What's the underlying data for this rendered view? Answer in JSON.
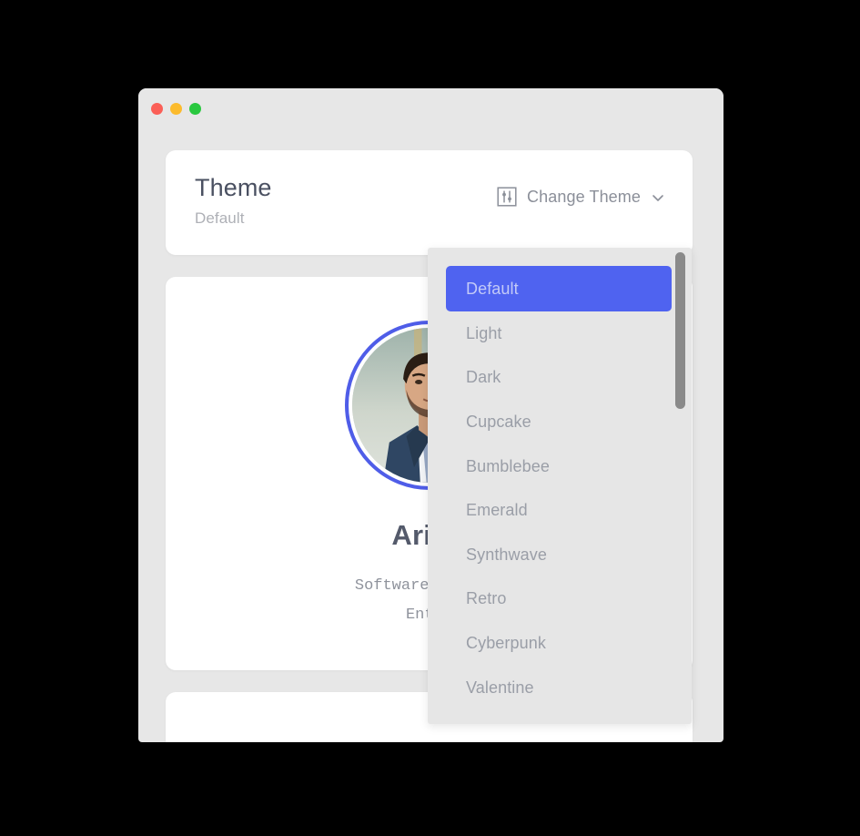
{
  "window": {
    "traffic_lights": [
      {
        "name": "close",
        "color": "#fb5f57"
      },
      {
        "name": "minimize",
        "color": "#fcbb2d"
      },
      {
        "name": "maximize",
        "color": "#29c83f"
      }
    ]
  },
  "theme_card": {
    "title": "Theme",
    "current_theme": "Default",
    "button_label": "Change Theme",
    "sliders_icon": "sliders-icon",
    "chevron_icon": "chevron-down-icon"
  },
  "profile_card": {
    "name": "Ariful",
    "role_line_1": "Software Enginee",
    "role_line_2": "Enthu",
    "avatar_icon": "avatar-photo",
    "avatar_ring_color": "#4f5de8"
  },
  "dropdown": {
    "selected": "Default",
    "accent_color": "#4f63f0",
    "background_color": "#e6e6e6",
    "items": [
      {
        "label": "Default",
        "selected": true
      },
      {
        "label": "Light",
        "selected": false
      },
      {
        "label": "Dark",
        "selected": false
      },
      {
        "label": "Cupcake",
        "selected": false
      },
      {
        "label": "Bumblebee",
        "selected": false
      },
      {
        "label": "Emerald",
        "selected": false
      },
      {
        "label": "Synthwave",
        "selected": false
      },
      {
        "label": "Retro",
        "selected": false
      },
      {
        "label": "Cyberpunk",
        "selected": false
      },
      {
        "label": "Valentine",
        "selected": false
      }
    ]
  }
}
